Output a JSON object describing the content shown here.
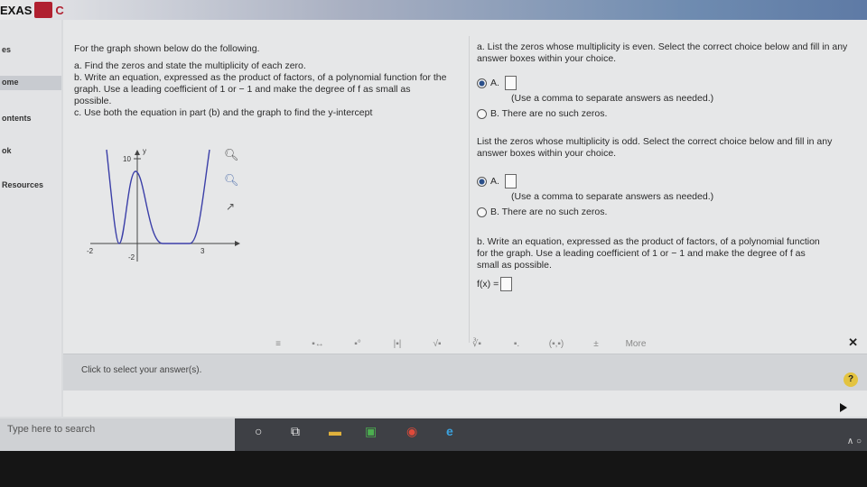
{
  "brand": {
    "left_text": "EXAS",
    "right_text": "C"
  },
  "sidebar": {
    "items": [
      {
        "label": "es"
      },
      {
        "label": "ome"
      },
      {
        "label": "ontents"
      },
      {
        "label": "ok"
      },
      {
        "label": "Resources"
      }
    ]
  },
  "question": {
    "intro": "For the graph shown below do the following.",
    "part_a": "a. Find the zeros and state the multiplicity of each zero.",
    "part_b": "b. Write an equation, expressed as the product of factors, of a polynomial function for the graph. Use a leading coefficient of 1 or − 1 and make the degree of f as small as possible.",
    "part_c": "c. Use both the equation in part (b) and the graph to find the y-intercept"
  },
  "graph": {
    "axis_y_label": "y",
    "tick_top": "10",
    "tick_left": "-2",
    "tick_bottom": "-2",
    "tick_right": "3"
  },
  "answer": {
    "even_prompt": "a. List the zeros whose multiplicity is even. Select the correct choice below and fill in any answer boxes within your choice.",
    "even_option_a": "A.",
    "even_hint": "(Use a comma to separate answers as needed.)",
    "even_option_b": "B.  There are no such zeros.",
    "odd_prompt": "List the zeros whose multiplicity is odd. Select the correct choice below and fill in any answer boxes within your choice.",
    "odd_option_a": "A.",
    "odd_hint": "(Use a comma to separate answers as needed.)",
    "odd_option_b": "B.  There are no such zeros.",
    "b_prompt": "b. Write an equation, expressed as the product of factors, of a polynomial function for the graph. Use a leading coefficient of 1 or − 1 and make the degree of f as small as possible.",
    "fx_label": "f(x) ="
  },
  "math_toolbar": {
    "buttons": [
      "≡",
      "▪↔",
      "▪°",
      "|▪|",
      "√▪",
      "∛▪",
      "▪.",
      "(▪,▪)",
      "±",
      "More"
    ]
  },
  "footer": {
    "instruction": "Click to select your answer(s).",
    "help_label": "?"
  },
  "taskbar": {
    "search_placeholder": "Type here to search",
    "tray_text": "∧ ○"
  }
}
